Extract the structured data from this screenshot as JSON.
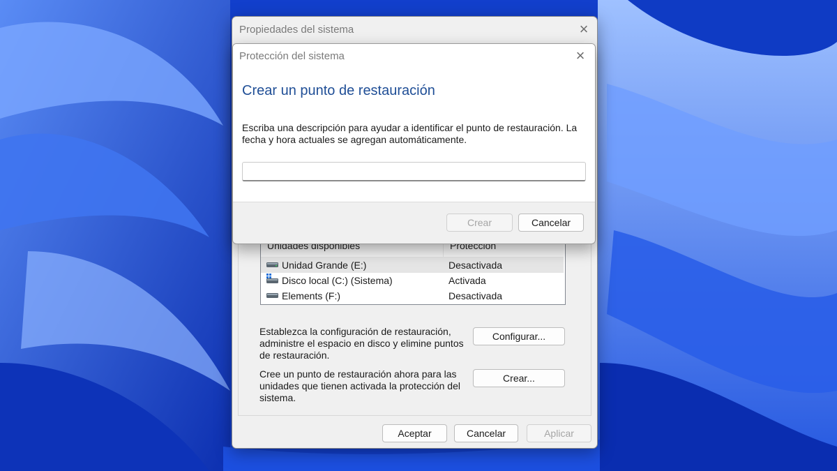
{
  "outer_dialog": {
    "title": "Propiedades del sistema",
    "close_glyph": "×",
    "drives_table": {
      "columns": [
        "Unidades disponibles",
        "Protección"
      ],
      "rows": [
        {
          "name": "Unidad Grande (E:)",
          "protection": "Desactivada",
          "icon": "drive-icon",
          "selected": true
        },
        {
          "name": "Disco local (C:) (Sistema)",
          "protection": "Activada",
          "icon": "system-drive-icon",
          "selected": false
        },
        {
          "name": "Elements (F:)",
          "protection": "Desactivada",
          "icon": "drive-icon",
          "selected": false
        }
      ]
    },
    "configure_text": "Establezca la configuración de restauración, administre el espacio en disco y elimine puntos de restauración.",
    "configure_button": "Configurar...",
    "create_text": "Cree un punto de restauración ahora para las unidades que tienen activada la protección del sistema.",
    "create_button": "Crear...",
    "ok_button": "Aceptar",
    "cancel_button": "Cancelar",
    "apply_button": "Aplicar"
  },
  "modal": {
    "title": "Protección del sistema",
    "close_glyph": "×",
    "heading": "Crear un punto de restauración",
    "description": "Escriba una descripción para ayudar a identificar el punto de restauración. La fecha y hora actuales se agregan automáticamente.",
    "input_value": "",
    "create_button": "Crear",
    "cancel_button": "Cancelar"
  },
  "colors": {
    "heading_blue": "#1f4e96",
    "wallpaper_blue": "#1846d6"
  }
}
